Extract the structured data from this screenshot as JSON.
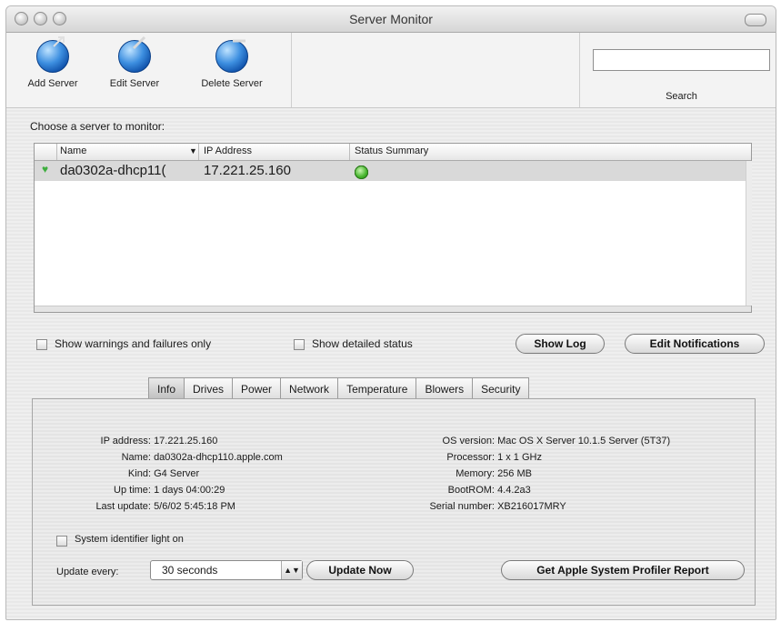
{
  "window": {
    "title": "Server Monitor"
  },
  "toolbar": {
    "add_server": "Add Server",
    "edit_server": "Edit Server",
    "delete_server": "Delete Server",
    "search_label": "Search",
    "search_value": ""
  },
  "main": {
    "choose_label": "Choose a server to monitor:",
    "columns": {
      "name": "Name",
      "ip": "IP Address",
      "status": "Status Summary"
    },
    "servers": [
      {
        "name": "da0302a-dhcp11(",
        "ip": "17.221.25.160",
        "status_color": "#47b52e"
      }
    ]
  },
  "options": {
    "warnings_only": "Show warnings and failures only",
    "detailed_status": "Show detailed status",
    "show_log": "Show Log",
    "edit_notifications": "Edit Notifications"
  },
  "tabs": [
    "Info",
    "Drives",
    "Power",
    "Network",
    "Temperature",
    "Blowers",
    "Security"
  ],
  "info": {
    "left": [
      {
        "label": "IP address:",
        "value": "17.221.25.160"
      },
      {
        "label": "Name:",
        "value": "da0302a-dhcp110.apple.com"
      },
      {
        "label": "Kind:",
        "value": "G4 Server"
      },
      {
        "label": "Up time:",
        "value": "1 days 04:00:29"
      },
      {
        "label": "Last update:",
        "value": "5/6/02 5:45:18 PM"
      }
    ],
    "right": [
      {
        "label": "OS version:",
        "value": "Mac OS X Server 10.1.5 Server (5T37)"
      },
      {
        "label": "Processor:",
        "value": "1 x 1 GHz"
      },
      {
        "label": "Memory:",
        "value": "256 MB"
      },
      {
        "label": "BootROM:",
        "value": "4.4.2a3"
      },
      {
        "label": "Serial number:",
        "value": "XB216017MRY"
      }
    ],
    "identifier_light": "System identifier light on",
    "update_every_label": "Update every:",
    "update_every_value": "30 seconds",
    "update_now": "Update Now",
    "profiler_report": "Get Apple System Profiler Report"
  },
  "colors": {
    "accent_blue": "#3d8fe0",
    "status_green": "#47b52e"
  }
}
